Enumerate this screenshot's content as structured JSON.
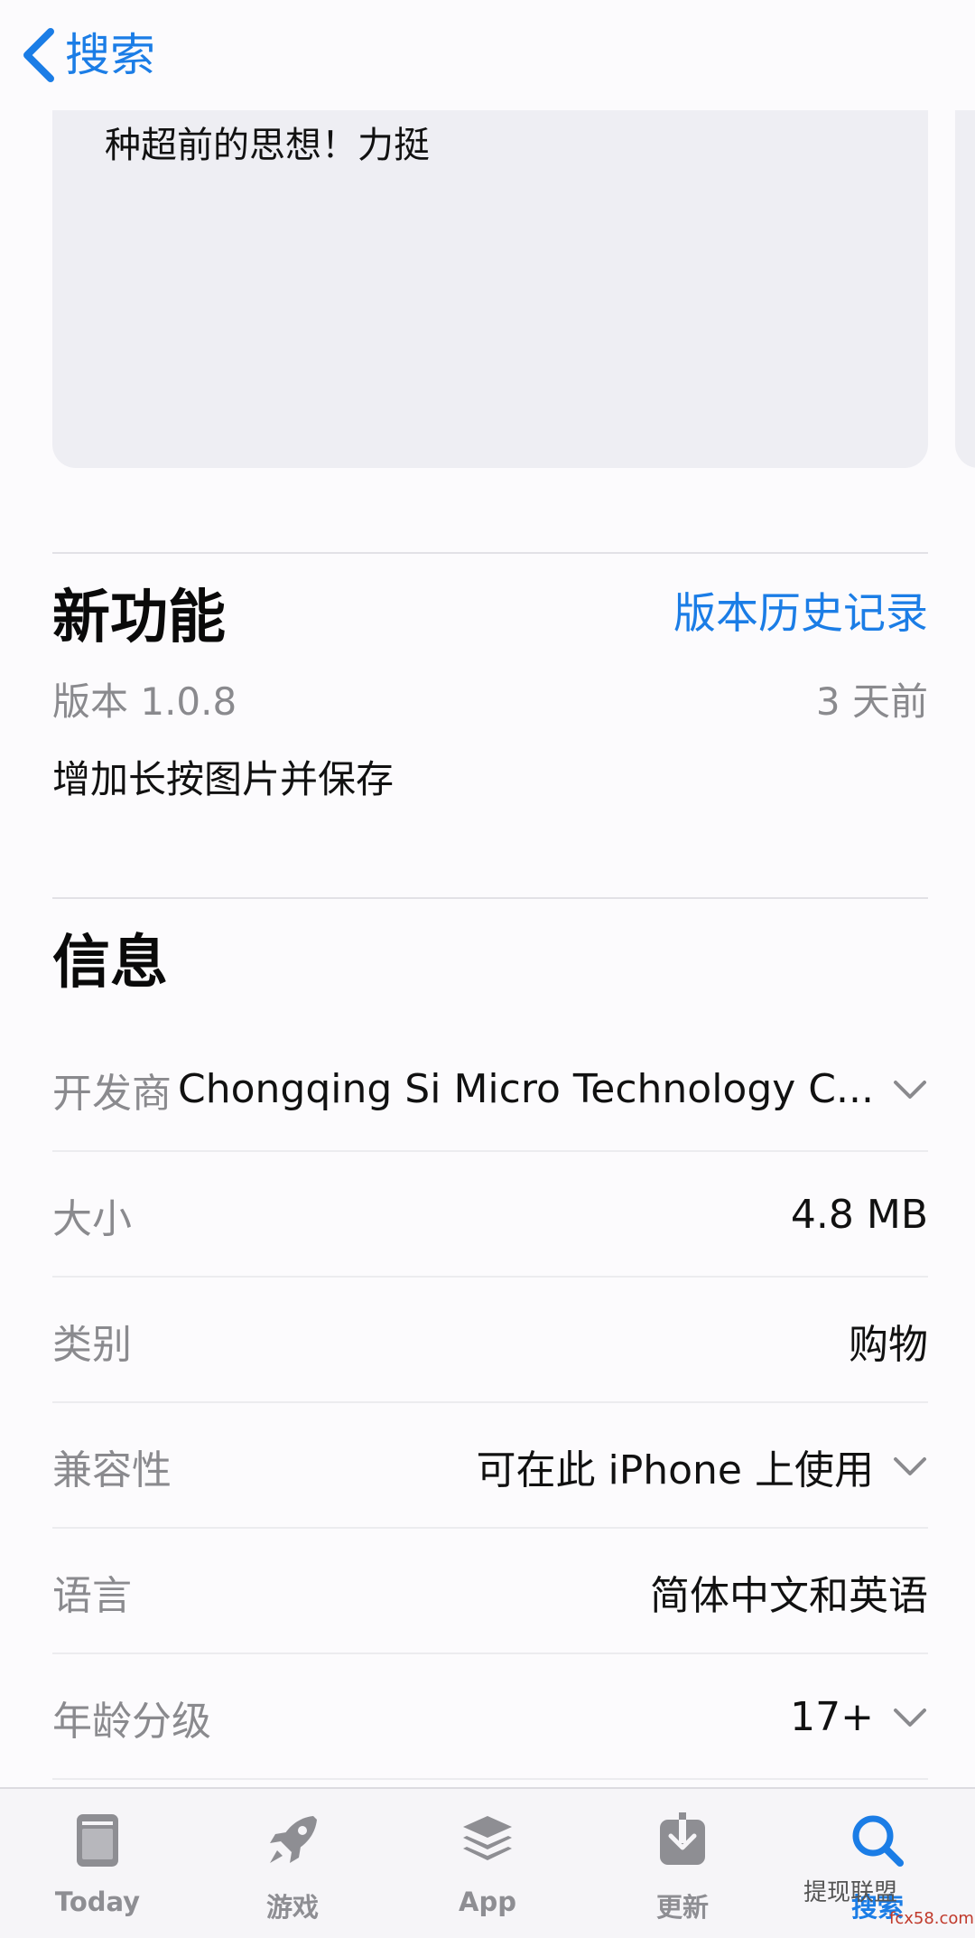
{
  "nav": {
    "back_label": "搜索"
  },
  "review": {
    "text": "种超前的思想！力挺"
  },
  "whats_new": {
    "title": "新功能",
    "history_link": "版本历史记录",
    "version": "版本 1.0.8",
    "age": "3 天前",
    "notes": "增加长按图片并保存"
  },
  "info": {
    "title": "信息",
    "rows": [
      {
        "label": "开发商",
        "value": "Chongqing Si Micro Technology C...",
        "expandable": true
      },
      {
        "label": "大小",
        "value": "4.8 MB",
        "expandable": false
      },
      {
        "label": "类别",
        "value": "购物",
        "expandable": false
      },
      {
        "label": "兼容性",
        "value": "可在此 iPhone 上使用",
        "expandable": true
      },
      {
        "label": "语言",
        "value": "简体中文和英语",
        "expandable": false
      },
      {
        "label": "年龄分级",
        "value": "17+",
        "expandable": true
      }
    ]
  },
  "tabbar": {
    "tabs": [
      {
        "label": "Today",
        "icon": "today-icon"
      },
      {
        "label": "游戏",
        "icon": "rocket-icon"
      },
      {
        "label": "App",
        "icon": "layers-icon"
      },
      {
        "label": "更新",
        "icon": "download-icon"
      },
      {
        "label": "搜索",
        "icon": "search-icon",
        "active": true
      }
    ]
  },
  "watermark": {
    "text": "提现联盟",
    "sub": "fcx58.com"
  },
  "colors": {
    "accent": "#1b7de6",
    "secondary_text": "#8a8a8e",
    "card_bg": "#eeeef3"
  }
}
